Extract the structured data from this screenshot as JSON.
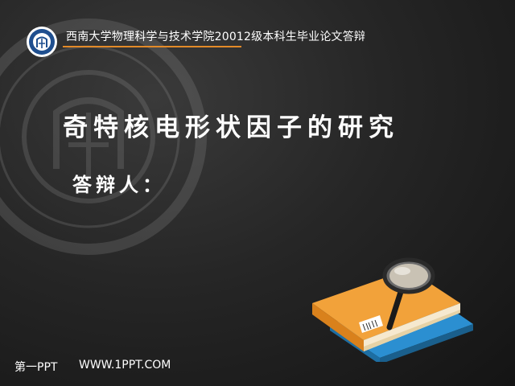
{
  "header": {
    "title": "西南大学物理科学与技术学院20012级本科生毕业论文答辩",
    "accent_color": "#e38a28",
    "logo_icon": "university-seal-icon"
  },
  "main": {
    "title": "奇特核电形状因子的研究",
    "defender_label": "答辩人："
  },
  "footer": {
    "brand": "第一PPT",
    "url": "WWW.1PPT.COM"
  },
  "decoration": {
    "watermark_icon": "university-seal-watermark",
    "illustration_icon": "books-magnifier-icon"
  }
}
